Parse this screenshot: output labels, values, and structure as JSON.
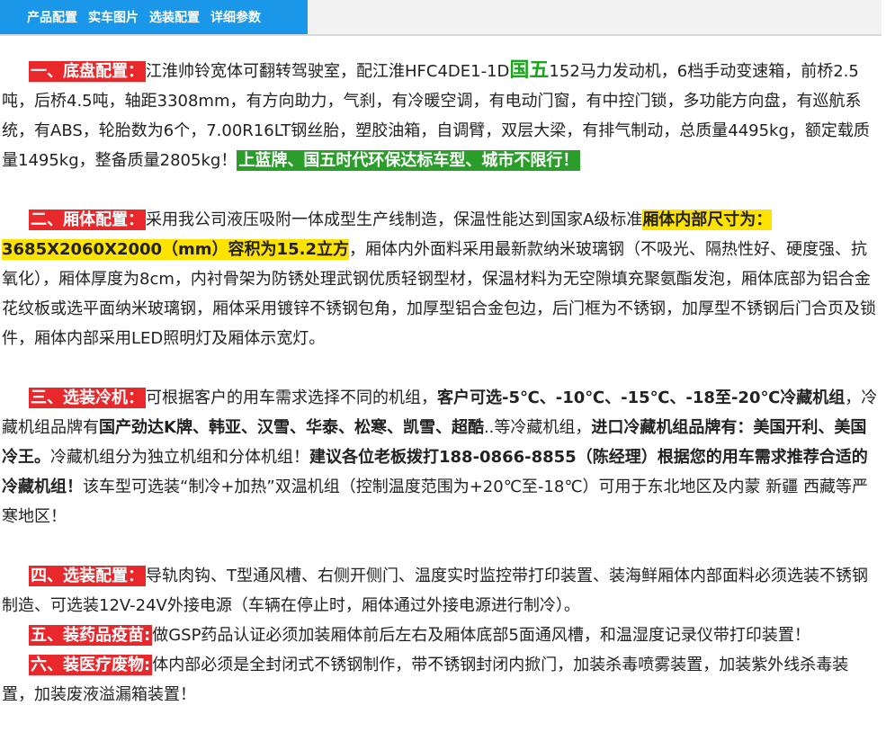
{
  "tabs": [
    "产品配置",
    "实车图片",
    "选装配置",
    "详细参数"
  ],
  "p1": {
    "heading": "一、底盘配置：",
    "t1": "江淮帅铃宽体可翻转驾驶室，配江淮HFC4DE1-1D",
    "emph": "国五",
    "t2": "152马力发动机，6档手动变速箱，前桥2.5吨，后桥4.5吨，轴距3308mm，有方向助力，气刹，有冷暖空调，有电动门窗，有中控门锁，多功能方向盘，有巡航系统，有ABS，轮胎数为6个，7.00R16LT钢丝胎，塑胶油箱，自调臂，双层大梁，有排气制动，总质量4495kg，额定载质量1495kg，整备质量2805kg！",
    "badge": "上蓝牌、国五时代环保达标车型、城市不限行！"
  },
  "p2": {
    "heading": "二、厢体配置：",
    "t1": "采用我公司液压吸附一体成型生产线制造，保温性能达到国家A级标准",
    "hl": "厢体内部尺寸为：3685X2060X2000（mm）容积为15.2立方",
    "t2": "，厢体内外面料采用最新款纳米玻璃钢（不吸光、隔热性好、硬度强、抗氧化），厢体厚度为8cm，内衬骨架为防锈处理武钢优质轻钢型材，保温材料为无空隙填充聚氨酯发泡，厢体底部为铝合金花纹板或选平面纳米玻璃钢，厢体采用镀锌不锈钢包角，加厚型铝合金包边，后门框为不锈钢，加厚型不锈钢后门合页及锁件，厢体内部采用LED照明灯及厢体示宽灯。"
  },
  "p3": {
    "heading": "三、选装冷机：",
    "t1": "可根据客户的用车需求选择不同的机组，",
    "b1": "客户可选-5℃、-10℃、-15℃、-18至-20℃冷藏机组",
    "t2": "，冷藏机组品牌有",
    "b2": "国产劲达K牌、韩亚、汉雪、华泰、松寒、凯雪、超酷",
    "t3": "..等冷藏机组，",
    "b3": "进口冷藏机组品牌有：美国开利、美国冷王。",
    "t4": "冷藏机组分为独立机组和分体机组！",
    "b4": "建议各位老板拨打188-0866-8855（陈经理）根据您的用车需求推荐合适的冷藏机组！",
    "t5": "该车型可选装“制冷+加热”双温机组（控制温度范围为+20℃至-18℃）可用于东北地区及内蒙 新疆 西藏等严寒地区！"
  },
  "p4": {
    "heading": "四、选装配置：",
    "t1": "导轨肉钩、T型通风槽、右侧开侧门、温度实时监控带打印装置、装海鲜厢体内部面料必须选装不锈钢制造、可选装12V-24V外接电源（车辆在停止时，厢体通过外接电源进行制冷）。"
  },
  "p5": {
    "heading": "五、装药品疫苗:",
    "t1": "做GSP药品认证必须加装厢体前后左右及厢体底部5面通风槽，和温湿度记录仪带打印装置！"
  },
  "p6": {
    "heading": "六、装医疗废物:",
    "t1": "体内部必须是全封闭式不锈钢制作，带不锈钢封闭内掀门，加装杀毒喷雾装置，加装紫外线杀毒装置，加装废液溢漏箱装置！"
  }
}
